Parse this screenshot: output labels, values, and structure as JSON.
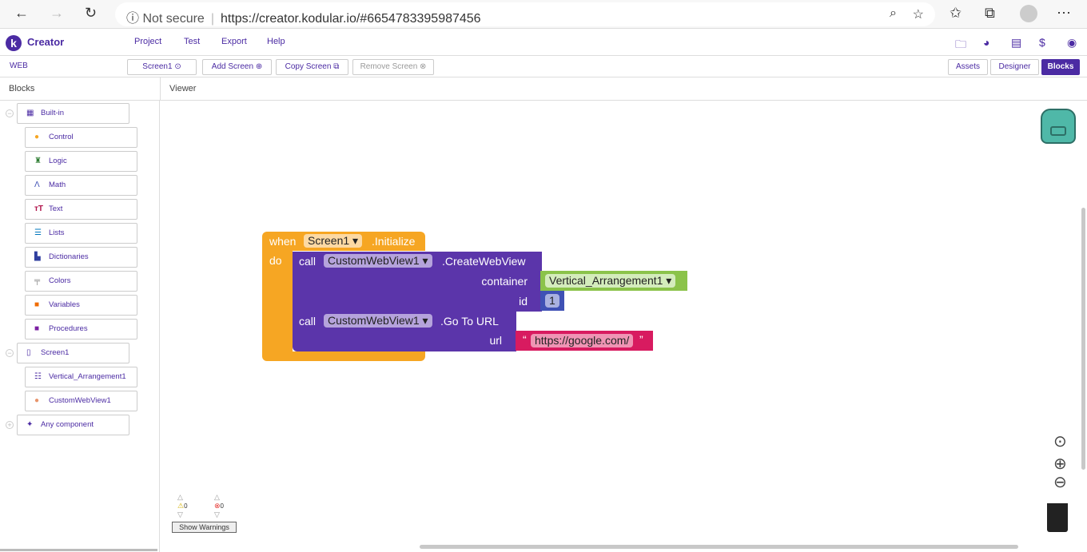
{
  "browser": {
    "back": "←",
    "forward": "→",
    "reload": "↻",
    "security": "Not secure",
    "url": "https://creator.kodular.io/#6654783395987456"
  },
  "app": {
    "logo": "k",
    "name": "Creator",
    "menu": [
      "Project",
      "Test",
      "Export",
      "Help"
    ],
    "project": "WEB",
    "screen_select": "Screen1 ⊙",
    "add_screen": "Add Screen ⊕",
    "copy_screen": "Copy Screen ⧉",
    "remove_screen": "Remove Screen ⊗",
    "views": [
      "Assets",
      "Designer",
      "Blocks"
    ],
    "active_view": "Blocks",
    "accent": "#4b2ba3"
  },
  "panels": {
    "blocks": "Blocks",
    "viewer": "Viewer"
  },
  "sidebar": {
    "builtin": {
      "label": "Built-in",
      "items": [
        "Control",
        "Logic",
        "Math",
        "Text",
        "Lists",
        "Dictionaries",
        "Colors",
        "Variables",
        "Procedures"
      ]
    },
    "screen": {
      "label": "Screen1",
      "items": [
        "Vertical_Arrangement1",
        "CustomWebView1"
      ]
    },
    "any": {
      "label": "Any component"
    }
  },
  "blocks": {
    "when": "when",
    "component": "Screen1",
    "event": ".Initialize",
    "do": "do",
    "call1": {
      "call": "call",
      "component": "CustomWebView1",
      "method": ".CreateWebView",
      "arg1": "container",
      "arg1_value": "Vertical_Arrangement1",
      "arg2": "id",
      "arg2_value": "1"
    },
    "call2": {
      "call": "call",
      "component": "CustomWebView1",
      "method": ".Go To URL",
      "arg1": "url",
      "arg1_value": "https://google.com/"
    },
    "colors": {
      "event": "#f6a623",
      "method": "#5b35aa",
      "component": "#8bc34a",
      "number": "#3f51b5",
      "text": "#d81b60"
    }
  },
  "warnings": {
    "warn_count": "0",
    "error_count": "0",
    "toggle": "Show Warnings"
  }
}
